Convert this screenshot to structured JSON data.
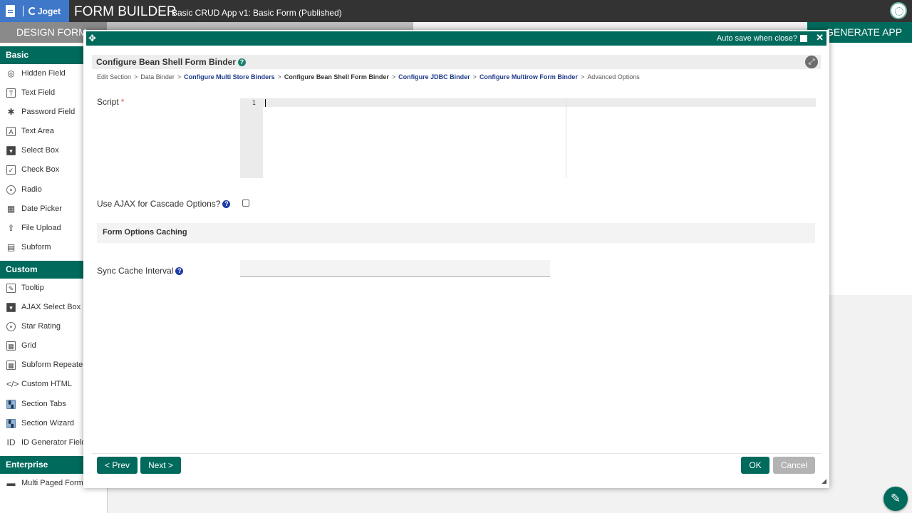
{
  "topbar": {
    "logo_text": "Joget",
    "title": "FORM BUILDER",
    "subtitle": "Basic CRUD App v1: Basic Form (Published)"
  },
  "builder_tabs": {
    "design": "DESIGN FORM",
    "generate": "GENERATE APP"
  },
  "palette": {
    "basic_header": "Basic",
    "basic_items": [
      {
        "label": "Hidden Field",
        "icon": "eye-slash-icon"
      },
      {
        "label": "Text Field",
        "icon": "text-field-icon"
      },
      {
        "label": "Password Field",
        "icon": "asterisk-icon"
      },
      {
        "label": "Text Area",
        "icon": "text-area-icon"
      },
      {
        "label": "Select Box",
        "icon": "select-box-icon"
      },
      {
        "label": "Check Box",
        "icon": "check-box-icon"
      },
      {
        "label": "Radio",
        "icon": "radio-icon"
      },
      {
        "label": "Date Picker",
        "icon": "calendar-icon"
      },
      {
        "label": "File Upload",
        "icon": "upload-icon"
      },
      {
        "label": "Subform",
        "icon": "subform-icon"
      }
    ],
    "custom_header": "Custom",
    "custom_items": [
      {
        "label": "Tooltip",
        "icon": "edit-icon"
      },
      {
        "label": "AJAX Select Box",
        "icon": "select-box-icon"
      },
      {
        "label": "Star Rating",
        "icon": "radio-icon"
      },
      {
        "label": "Grid",
        "icon": "grid-icon"
      },
      {
        "label": "Subform Repeater",
        "icon": "grid-icon"
      },
      {
        "label": "Custom HTML",
        "icon": "code-icon"
      },
      {
        "label": "Section Tabs",
        "icon": "section-icon"
      },
      {
        "label": "Section Wizard",
        "icon": "section-icon"
      },
      {
        "label": "ID Generator Field",
        "icon": "id-icon"
      }
    ],
    "enterprise_header": "Enterprise",
    "enterprise_items": [
      {
        "label": "Multi Paged Form",
        "icon": "multi-page-icon"
      }
    ]
  },
  "dialog": {
    "autosave_label": "Auto save when close?",
    "title": "Configure Bean Shell Form Binder",
    "breadcrumb": [
      {
        "label": "Edit Section",
        "style": "plain"
      },
      {
        "label": "Data Binder",
        "style": "plain"
      },
      {
        "label": "Configure Multi Store Binders",
        "style": "link"
      },
      {
        "label": "Configure Bean Shell Form Binder",
        "style": "current"
      },
      {
        "label": "Configure JDBC Binder",
        "style": "link"
      },
      {
        "label": "Configure Multirow Form Binder",
        "style": "link"
      },
      {
        "label": "Advanced Options",
        "style": "plain"
      }
    ],
    "script_label": "Script",
    "required_mark": "*",
    "script_line_number": "1",
    "script_value": "",
    "ajax_label": "Use AJAX for Cascade Options?",
    "ajax_checked": false,
    "section_title": "Form Options Caching",
    "sync_label": "Sync Cache Interval",
    "sync_value": "",
    "prev_label": "< Prev",
    "next_label": "Next >",
    "ok_label": "OK",
    "cancel_label": "Cancel"
  },
  "colors": {
    "primary": "#006a5c",
    "topbar": "#333333",
    "logo_bg": "#3f78c9",
    "help_blue": "#1e3da8",
    "link": "#1e3a8a",
    "required": "#d9534f"
  }
}
